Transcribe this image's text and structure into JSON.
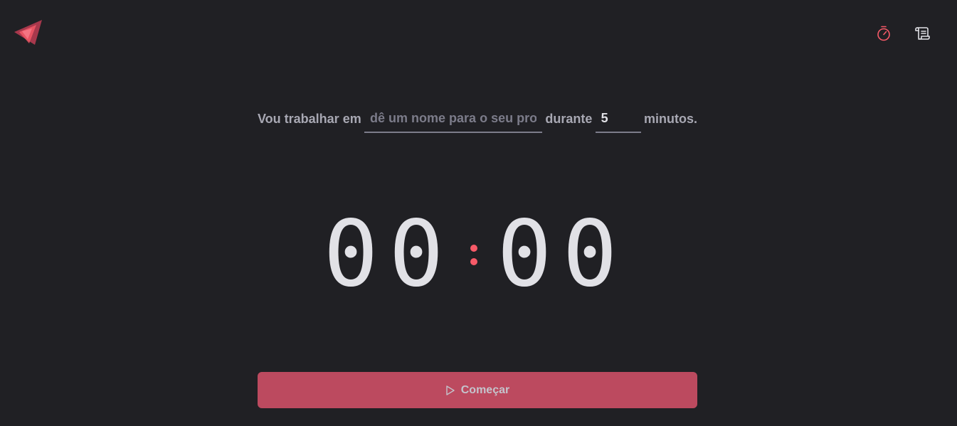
{
  "header": {
    "logo_icon": "triangle-logo-icon",
    "nav": [
      {
        "icon": "timer-icon",
        "active": true,
        "color": "#f75a68"
      },
      {
        "icon": "scroll-icon",
        "active": false,
        "color": "#e1e1e6"
      }
    ]
  },
  "form": {
    "label_task": "Vou trabalhar em",
    "task_placeholder": "dê um nome para o seu projeto",
    "task_value": "",
    "label_during": "durante",
    "minutes_value": "5",
    "label_minutes": "minutos."
  },
  "countdown": {
    "minute_tens": "0",
    "minute_ones": "0",
    "second_tens": "0",
    "second_ones": "0",
    "separator": ":"
  },
  "start_button": {
    "label": "Começar",
    "icon": "play-icon",
    "color": "#bc4a5f"
  },
  "colors": {
    "background": "#202024",
    "accent": "#f75a68",
    "text": "#e1e1e6",
    "muted": "#a8a8b3"
  }
}
